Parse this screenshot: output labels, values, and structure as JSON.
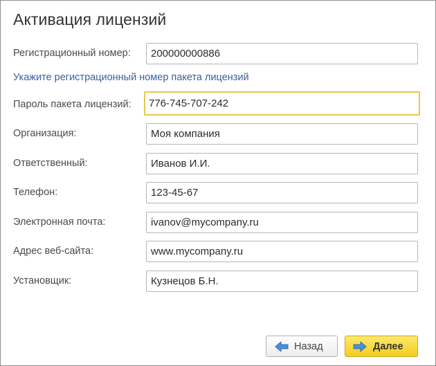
{
  "dialog": {
    "title": "Активация лицензий",
    "hint": "Укажите регистрационный номер пакета лицензий"
  },
  "form": {
    "fields": [
      {
        "label": "Регистрационный номер:",
        "value": "200000000886"
      },
      {
        "label": "Пароль пакета лицензий:",
        "value": "776-745-707-242"
      },
      {
        "label": "Организация:",
        "value": "Моя компания"
      },
      {
        "label": "Ответственный:",
        "value": "Иванов И.И."
      },
      {
        "label": "Телефон:",
        "value": "123-45-67"
      },
      {
        "label": "Электронная почта:",
        "value": "ivanov@mycompany.ru"
      },
      {
        "label": "Адрес веб-сайта:",
        "value": "www.mycompany.ru"
      },
      {
        "label": "Установщик:",
        "value": "Кузнецов Б.Н."
      }
    ]
  },
  "buttons": {
    "back_label": "Назад",
    "back_icon": "arrow-left-icon",
    "next_label": "Далее",
    "next_icon": "arrow-right-icon"
  },
  "colors": {
    "focus_border": "#e8c64a",
    "hint_text": "#3a5f9e",
    "primary_button": "#f6d42e",
    "arrow_icon": "#4a90d9"
  }
}
